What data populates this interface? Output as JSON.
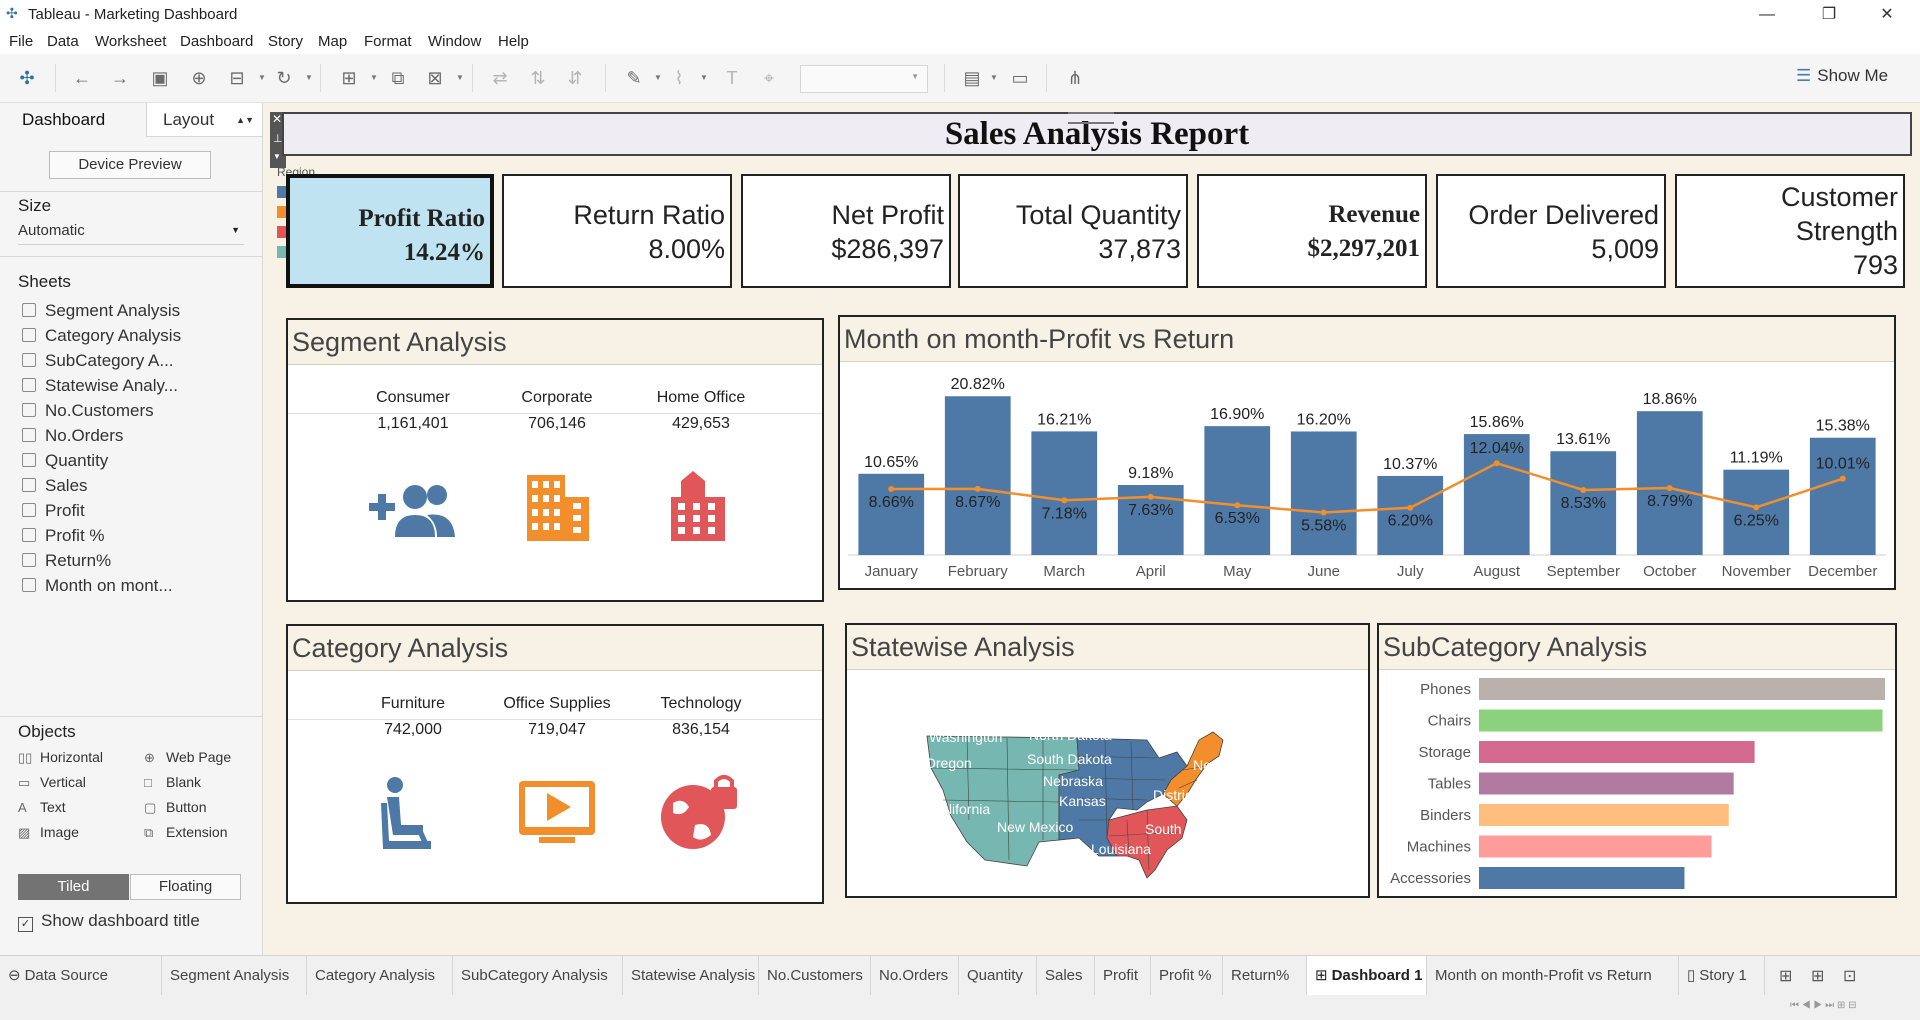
{
  "window": {
    "title": "Tableau - Marketing Dashboard"
  },
  "menu": [
    "File",
    "Data",
    "Worksheet",
    "Dashboard",
    "Story",
    "Map",
    "Format",
    "Window",
    "Help"
  ],
  "toolbar": {
    "show_me": "Show Me"
  },
  "left_panel": {
    "tabs": {
      "dashboard": "Dashboard",
      "layout": "Layout"
    },
    "device_preview": "Device Preview",
    "size_label": "Size",
    "size_value": "Automatic",
    "sheets_label": "Sheets",
    "sheets": [
      "Segment Analysis",
      "Category Analysis",
      "SubCategory A...",
      "Statewise Analy...",
      "No.Customers",
      "No.Orders",
      "Quantity",
      "Sales",
      "Profit",
      "Profit %",
      "Return%",
      "Month on mont..."
    ],
    "objects_label": "Objects",
    "objects": [
      {
        "label": "Horizontal",
        "icon": "horizontal-icon"
      },
      {
        "label": "Web Page",
        "icon": "globe-icon"
      },
      {
        "label": "Vertical",
        "icon": "vertical-icon"
      },
      {
        "label": "Blank",
        "icon": "blank-icon"
      },
      {
        "label": "Text",
        "icon": "text-icon"
      },
      {
        "label": "Button",
        "icon": "button-icon"
      },
      {
        "label": "Image",
        "icon": "image-icon"
      },
      {
        "label": "Extension",
        "icon": "extension-icon"
      }
    ],
    "tiled": "Tiled",
    "floating": "Floating",
    "show_title": "Show dashboard title"
  },
  "dashboard": {
    "title": "Sales Analysis Report",
    "legend_label": "Region",
    "legend_colors": [
      "#4e79a7",
      "#f28e2b",
      "#e15759",
      "#76b7b2"
    ],
    "kpis": [
      {
        "label": "Profit Ratio",
        "value": "14.24%"
      },
      {
        "label": "Return Ratio",
        "value": "8.00%"
      },
      {
        "label": "Net Profit",
        "value": "$286,397"
      },
      {
        "label": "Total Quantity",
        "value": "37,873"
      },
      {
        "label": "Revenue",
        "value": "$2,297,201"
      },
      {
        "label": "Order Delivered",
        "value": "5,009"
      },
      {
        "label": "Customer Strength",
        "value": "793"
      }
    ],
    "segment": {
      "title": "Segment Analysis",
      "columns": [
        {
          "name": "Consumer",
          "value": "1,161,401",
          "icon": "add-people-icon",
          "color": "#4e79a7"
        },
        {
          "name": "Corporate",
          "value": "706,146",
          "icon": "office-building-icon",
          "color": "#f28e2b"
        },
        {
          "name": "Home Office",
          "value": "429,653",
          "icon": "home-building-icon",
          "color": "#e15759"
        }
      ]
    },
    "category": {
      "title": "Category Analysis",
      "columns": [
        {
          "name": "Furniture",
          "value": "742,000",
          "icon": "chair-person-icon",
          "color": "#4e79a7"
        },
        {
          "name": "Office Supplies",
          "value": "719,047",
          "icon": "monitor-play-icon",
          "color": "#f28e2b"
        },
        {
          "name": "Technology",
          "value": "836,154",
          "icon": "globe-lock-icon",
          "color": "#e15759"
        }
      ]
    },
    "statewise": {
      "title": "Statewise Analysis",
      "map_labels": [
        "Washington",
        "North Dakota",
        "Oregon",
        "South Dakota",
        "Nebraska",
        "Kansas",
        "California",
        "New Mexico",
        "Louisiana",
        "South Ca...",
        "District of C...",
        "New Ham..."
      ]
    }
  },
  "chart_data": [
    {
      "type": "bar",
      "title": "Month on month-Profit vs Return",
      "categories": [
        "January",
        "February",
        "March",
        "April",
        "May",
        "June",
        "July",
        "August",
        "September",
        "October",
        "November",
        "December"
      ],
      "series": [
        {
          "values": [
            10.65,
            20.82,
            16.21,
            9.18,
            16.9,
            16.2,
            10.37,
            15.86,
            13.61,
            18.86,
            11.19,
            15.38
          ]
        },
        {
          "type": "line",
          "values": [
            8.66,
            8.67,
            7.18,
            7.63,
            6.53,
            5.58,
            6.2,
            12.04,
            8.53,
            8.79,
            6.25,
            10.01
          ]
        }
      ],
      "colors": {
        "bar": "#4e79a7",
        "line": "#f28e2b"
      },
      "ylim": [
        0,
        24
      ]
    },
    {
      "type": "bar",
      "orientation": "horizontal",
      "title": "SubCategory Analysis",
      "categories": [
        "Phones",
        "Chairs",
        "Storage",
        "Tables",
        "Binders",
        "Machines",
        "Accessories"
      ],
      "values": [
        330000,
        328000,
        224000,
        207000,
        203000,
        189000,
        167000
      ],
      "colors": [
        "#bab0ac",
        "#8cd17d",
        "#d4698f",
        "#b07aa1",
        "#ffbe7d",
        "#ff9d9a",
        "#4e79a7"
      ]
    }
  ],
  "bottom_tabs": [
    "Data Source",
    "Segment Analysis",
    "Category Analysis",
    "SubCategory Analysis",
    "Statewise Analysis",
    "No.Customers",
    "No.Orders",
    "Quantity",
    "Sales",
    "Profit",
    "Profit %",
    "Return%",
    "Dashboard 1",
    "Month on month-Profit vs Return",
    "Story 1"
  ],
  "active_tab": "Dashboard 1"
}
